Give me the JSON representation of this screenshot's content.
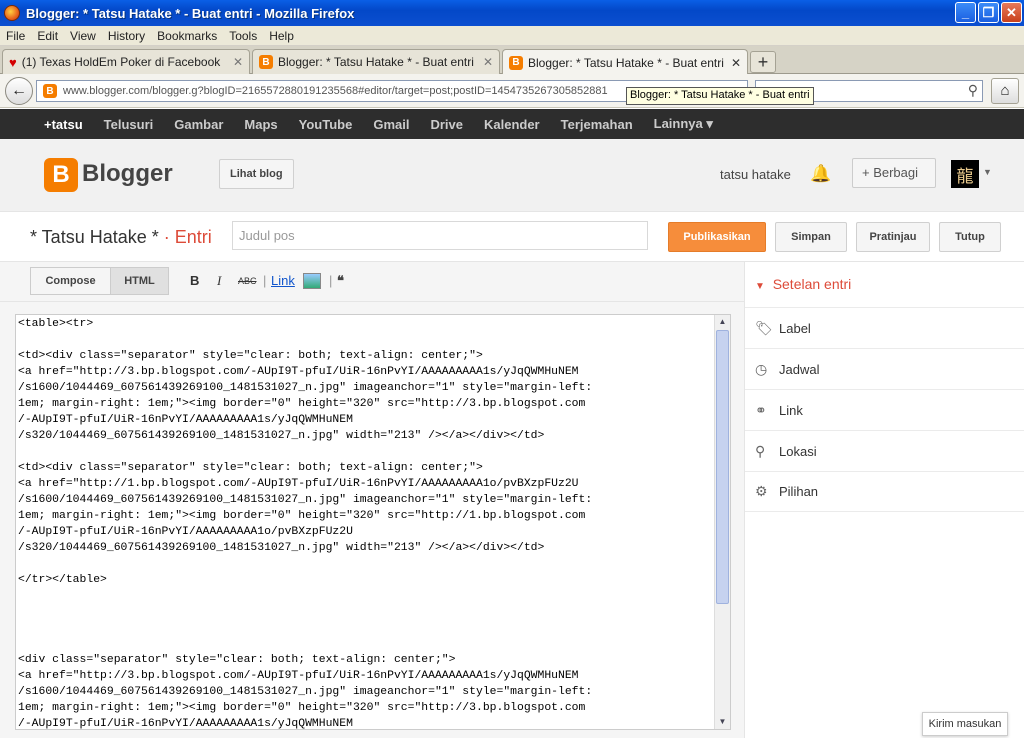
{
  "window": {
    "title": "Blogger: * Tatsu Hatake * - Buat entri - Mozilla Firefox"
  },
  "menu": [
    "File",
    "Edit",
    "View",
    "History",
    "Bookmarks",
    "Tools",
    "Help"
  ],
  "tabs": [
    {
      "label": "(1) Texas HoldEm Poker di Facebook"
    },
    {
      "label": "Blogger: * Tatsu Hatake * - Buat entri"
    },
    {
      "label": "Blogger: * Tatsu Hatake * - Buat entri"
    }
  ],
  "url": "www.blogger.com/blogger.g?blogID=2165572880191235568#editor/target=post;postID=1454735267305852881",
  "tooltip": "Blogger: * Tatsu Hatake * - Buat entri",
  "gbar": [
    "+tatsu",
    "Telusuri",
    "Gambar",
    "Maps",
    "YouTube",
    "Gmail",
    "Drive",
    "Kalender",
    "Terjemahan",
    "Lainnya ▾"
  ],
  "header": {
    "brand": "Blogger",
    "view_blog": "Lihat blog",
    "user": "tatsu hatake",
    "share": "+ Berbagi",
    "avatar": "龍"
  },
  "entry": {
    "blog": "* Tatsu Hatake *",
    "sep": " · ",
    "section": "Entri",
    "title_placeholder": "Judul pos",
    "publish": "Publikasikan",
    "save": "Simpan",
    "preview": "Pratinjau",
    "close": "Tutup"
  },
  "toolbar": {
    "compose": "Compose",
    "html": "HTML",
    "bold": "B",
    "italic": "I",
    "spell": "ABC",
    "link": "Link",
    "quote": "❝"
  },
  "code": "<table><tr>\n\n<td><div class=\"separator\" style=\"clear: both; text-align: center;\">\n<a href=\"http://3.bp.blogspot.com/-AUpI9T-pfuI/UiR-16nPvYI/AAAAAAAAA1s/yJqQWMHuNEM\n/s1600/1044469_607561439269100_1481531027_n.jpg\" imageanchor=\"1\" style=\"margin-left:\n1em; margin-right: 1em;\"><img border=\"0\" height=\"320\" src=\"http://3.bp.blogspot.com\n/-AUpI9T-pfuI/UiR-16nPvYI/AAAAAAAAA1s/yJqQWMHuNEM\n/s320/1044469_607561439269100_1481531027_n.jpg\" width=\"213\" /></a></div></td>\n\n<td><div class=\"separator\" style=\"clear: both; text-align: center;\">\n<a href=\"http://1.bp.blogspot.com/-AUpI9T-pfuI/UiR-16nPvYI/AAAAAAAAA1o/pvBXzpFUz2U\n/s1600/1044469_607561439269100_1481531027_n.jpg\" imageanchor=\"1\" style=\"margin-left:\n1em; margin-right: 1em;\"><img border=\"0\" height=\"320\" src=\"http://1.bp.blogspot.com\n/-AUpI9T-pfuI/UiR-16nPvYI/AAAAAAAAA1o/pvBXzpFUz2U\n/s320/1044469_607561439269100_1481531027_n.jpg\" width=\"213\" /></a></div></td>\n\n</tr></table>\n\n\n\n\n<div class=\"separator\" style=\"clear: both; text-align: center;\">\n<a href=\"http://3.bp.blogspot.com/-AUpI9T-pfuI/UiR-16nPvYI/AAAAAAAAA1s/yJqQWMHuNEM\n/s1600/1044469_607561439269100_1481531027_n.jpg\" imageanchor=\"1\" style=\"margin-left:\n1em; margin-right: 1em;\"><img border=\"0\" height=\"320\" src=\"http://3.bp.blogspot.com\n/-AUpI9T-pfuI/UiR-16nPvYI/AAAAAAAAA1s/yJqQWMHuNEM",
  "sidebar": {
    "heading": "Setelan entri",
    "items": [
      "Label",
      "Jadwal",
      "Link",
      "Lokasi",
      "Pilihan"
    ]
  },
  "feedback": "Kirim masukan",
  "colors": {
    "accent": "#f68d3b",
    "brand": "#f57d00",
    "link": "#dd4b39"
  }
}
